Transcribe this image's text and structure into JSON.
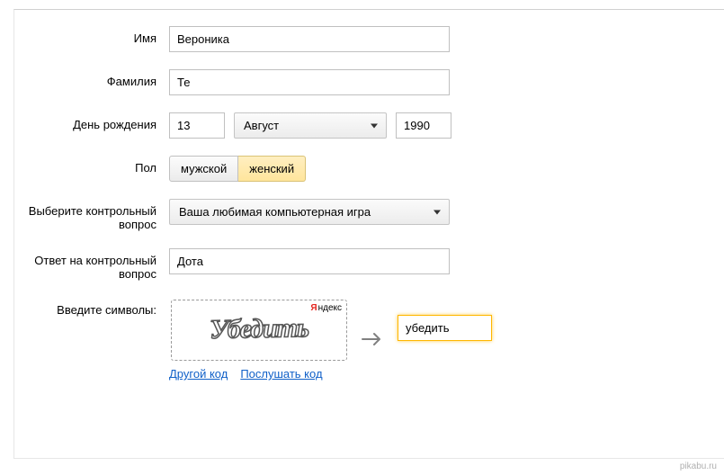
{
  "labels": {
    "first_name": "Имя",
    "last_name": "Фамилия",
    "birthday": "День рождения",
    "gender": "Пол",
    "security_question": "Выберите контрольный вопрос",
    "security_answer": "Ответ на контрольный вопрос",
    "captcha": "Введите символы:"
  },
  "values": {
    "first_name": "Вероника",
    "last_name": "Те",
    "birth_day": "13",
    "birth_month": "Август",
    "birth_year": "1990",
    "gender_male": "мужской",
    "gender_female": "женский",
    "gender_selected": "female",
    "security_question": "Ваша любимая компьютерная игра",
    "security_answer": "Дота",
    "captcha_input": "убедить"
  },
  "captcha": {
    "image_text": "Убедить",
    "brand": "ндекс",
    "brand_letter": "Я",
    "link_other": "Другой код",
    "link_listen": "Послушать код"
  },
  "watermark": "pikabu.ru"
}
